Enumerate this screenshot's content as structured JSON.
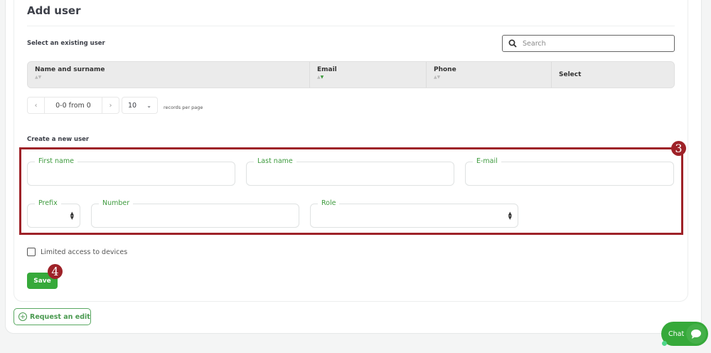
{
  "page": {
    "title": "Add user"
  },
  "existing": {
    "label": "Select an existing user",
    "search_placeholder": "Search",
    "columns": [
      {
        "label": "Name and surname"
      },
      {
        "label": "Email"
      },
      {
        "label": "Phone"
      },
      {
        "label": "Select"
      }
    ],
    "pager": {
      "prev": "‹",
      "range": "0-0 from 0",
      "next": "›",
      "per_page": "10",
      "per_page_label": "records per page"
    }
  },
  "create": {
    "label": "Create a new user",
    "fields": {
      "first_name": "First name",
      "last_name": "Last name",
      "email": "E-mail",
      "prefix": "Prefix",
      "number": "Number",
      "role": "Role"
    },
    "limited_access": "Limited access to devices",
    "save": "Save"
  },
  "annotations": {
    "step3": "3",
    "step4": "4"
  },
  "request_edit": "Request an edit",
  "chat": "Chat",
  "colors": {
    "accent": "#36a93a",
    "highlight": "#9e2228"
  }
}
